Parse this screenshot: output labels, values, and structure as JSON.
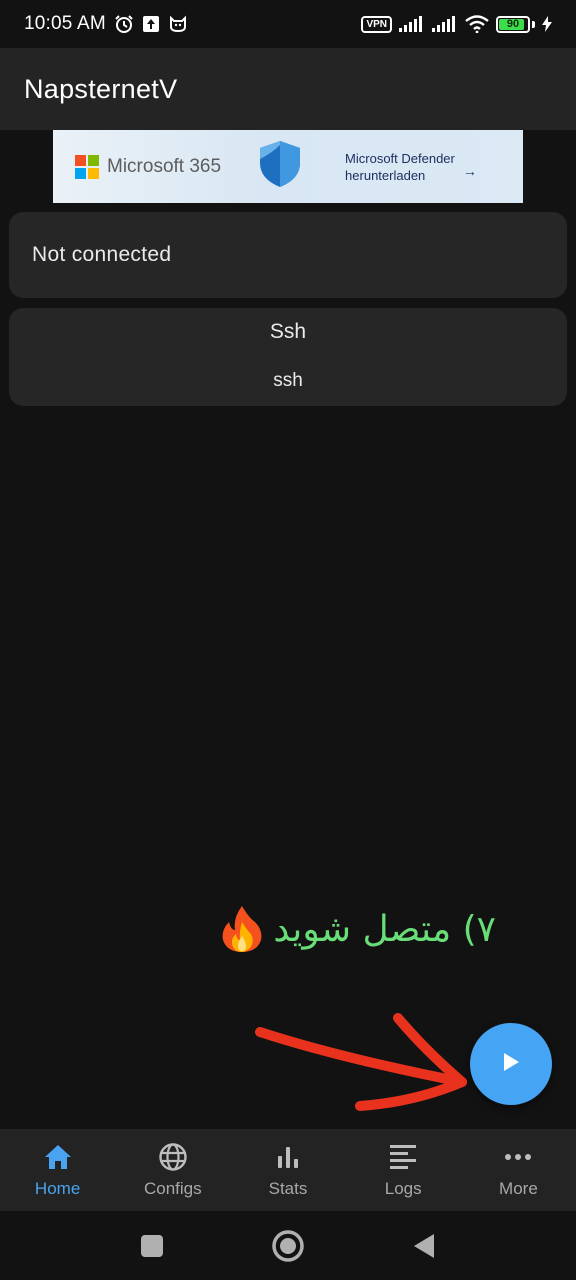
{
  "status_bar": {
    "time": "10:05 AM",
    "vpn_label": "VPN",
    "battery_percent": 90,
    "battery_label": "90",
    "battery_color": "#3ddc4a",
    "icons": [
      "alarm-icon",
      "upload-icon",
      "cat-icon",
      "signal-icon",
      "signal-icon",
      "wifi-icon",
      "charging-icon"
    ]
  },
  "app_bar": {
    "title": "NapsternetV"
  },
  "ad": {
    "brand": "Microsoft 365",
    "cta_line1": "Microsoft Defender",
    "cta_line2": "herunterladen",
    "arrow": "→"
  },
  "connection": {
    "status": "Not connected"
  },
  "config": {
    "name": "Ssh",
    "type": "ssh"
  },
  "annotation": {
    "text": "۷) متصل شوید",
    "icon": "fire-icon",
    "color": "#69dd78"
  },
  "fab": {
    "icon": "play-icon",
    "color": "#45a4f3"
  },
  "bottom_nav": {
    "active_color": "#4aa3f0",
    "items": [
      {
        "label": "Home",
        "icon": "home-icon"
      },
      {
        "label": "Configs",
        "icon": "globe-icon"
      },
      {
        "label": "Stats",
        "icon": "bar-chart-icon"
      },
      {
        "label": "Logs",
        "icon": "list-icon"
      },
      {
        "label": "More",
        "icon": "more-icon"
      }
    ]
  },
  "system_nav": {
    "icons": [
      "recents-icon",
      "home-circle-icon",
      "back-icon"
    ]
  }
}
